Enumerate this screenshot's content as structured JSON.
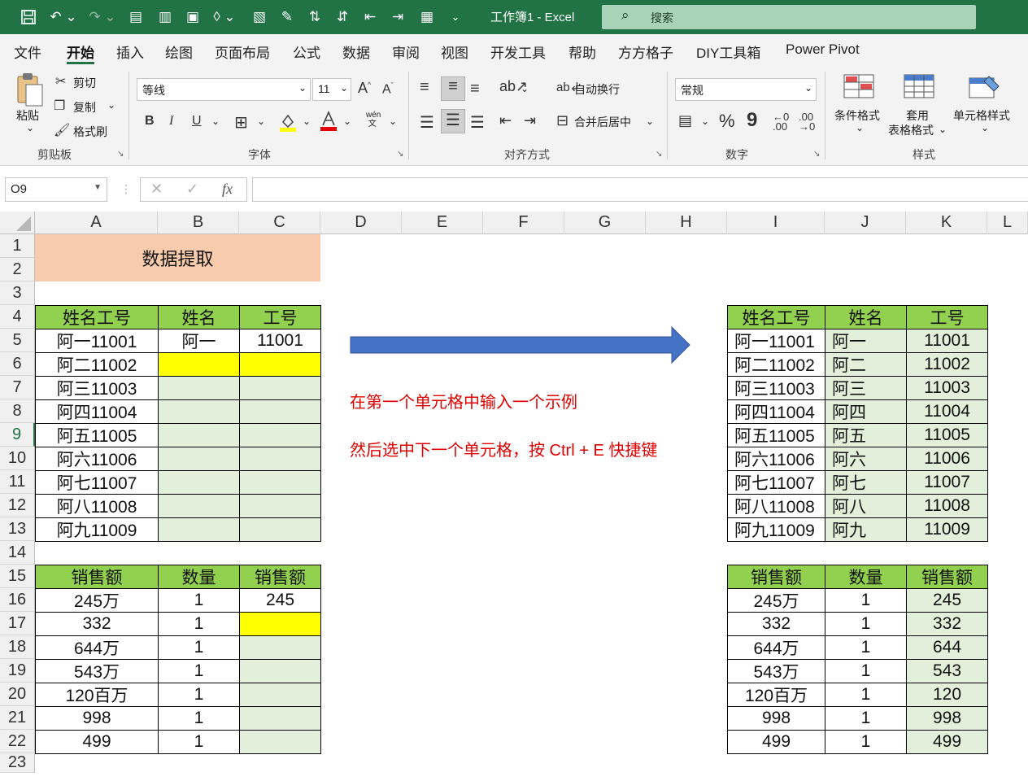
{
  "app": {
    "title": "工作簿1  -  Excel",
    "search_placeholder": "搜索"
  },
  "menu": [
    "文件",
    "开始",
    "插入",
    "绘图",
    "页面布局",
    "公式",
    "数据",
    "审阅",
    "视图",
    "开发工具",
    "帮助",
    "方方格子",
    "DIY工具箱",
    "Power Pivot"
  ],
  "ribbon": {
    "clipboard": {
      "paste": "粘贴",
      "cut": "剪切",
      "copy": "复制",
      "format_painter": "格式刷",
      "group": "剪贴板"
    },
    "font": {
      "name": "等线",
      "size": "11",
      "bold": "B",
      "italic": "I",
      "underline": "U",
      "group": "字体"
    },
    "alignment": {
      "wrap": "自动换行",
      "merge": "合并后居中",
      "group": "对齐方式"
    },
    "number": {
      "format": "常规",
      "percent": "%",
      "comma": "9",
      "group": "数字"
    },
    "styles": {
      "conditional": "条件格式",
      "table1": "套用",
      "table2": "表格格式",
      "cell_styles": "单元格样式",
      "group": "样式"
    }
  },
  "formula_bar": {
    "name_box": "O9",
    "fx": "fx",
    "cancel": "✕",
    "enter": "✓"
  },
  "columns": [
    "A",
    "B",
    "C",
    "D",
    "E",
    "F",
    "G",
    "H",
    "I",
    "J",
    "K",
    "L"
  ],
  "rows": [
    "1",
    "2",
    "3",
    "4",
    "5",
    "6",
    "7",
    "8",
    "9",
    "10",
    "11",
    "12",
    "13",
    "14",
    "15",
    "16",
    "17",
    "18",
    "19",
    "20",
    "21",
    "22",
    "23"
  ],
  "banner": "数据提取",
  "left_table1": {
    "headers": [
      "姓名工号",
      "姓名",
      "工号"
    ],
    "rows": [
      [
        "阿一11001",
        "阿一",
        "11001"
      ],
      [
        "阿二11002",
        "",
        ""
      ],
      [
        "阿三11003",
        "",
        ""
      ],
      [
        "阿四11004",
        "",
        ""
      ],
      [
        "阿五11005",
        "",
        ""
      ],
      [
        "阿六11006",
        "",
        ""
      ],
      [
        "阿七11007",
        "",
        ""
      ],
      [
        "阿八11008",
        "",
        ""
      ],
      [
        "阿九11009",
        "",
        ""
      ]
    ]
  },
  "left_table2": {
    "headers": [
      "销售额",
      "数量",
      "销售额"
    ],
    "rows": [
      [
        "245万",
        "1",
        "245"
      ],
      [
        "332",
        "1",
        ""
      ],
      [
        "644万",
        "1",
        ""
      ],
      [
        "543万",
        "1",
        ""
      ],
      [
        "120百万",
        "1",
        ""
      ],
      [
        "998",
        "1",
        ""
      ],
      [
        "499",
        "1",
        ""
      ]
    ]
  },
  "right_table1": {
    "headers": [
      "姓名工号",
      "姓名",
      "工号"
    ],
    "rows": [
      [
        "阿一11001",
        "阿一",
        "11001"
      ],
      [
        "阿二11002",
        "阿二",
        "11002"
      ],
      [
        "阿三11003",
        "阿三",
        "11003"
      ],
      [
        "阿四11004",
        "阿四",
        "11004"
      ],
      [
        "阿五11005",
        "阿五",
        "11005"
      ],
      [
        "阿六11006",
        "阿六",
        "11006"
      ],
      [
        "阿七11007",
        "阿七",
        "11007"
      ],
      [
        "阿八11008",
        "阿八",
        "11008"
      ],
      [
        "阿九11009",
        "阿九",
        "11009"
      ]
    ]
  },
  "right_table2": {
    "headers": [
      "销售额",
      "数量",
      "销售额"
    ],
    "rows": [
      [
        "245万",
        "1",
        "245"
      ],
      [
        "332",
        "1",
        "332"
      ],
      [
        "644万",
        "1",
        "644"
      ],
      [
        "543万",
        "1",
        "543"
      ],
      [
        "120百万",
        "1",
        "120"
      ],
      [
        "998",
        "1",
        "998"
      ],
      [
        "499",
        "1",
        "499"
      ]
    ]
  },
  "notes": [
    "在第一个单元格中输入一个示例",
    "然后选中下一个单元格，按 Ctrl + E 快捷键"
  ],
  "colors": {
    "header_green": "#92d050",
    "fill_light_green": "#e2efda",
    "highlight_yellow": "#ffff00",
    "banner": "#f8cbad",
    "arrow": "#4472c4",
    "note_red": "#e00000"
  }
}
